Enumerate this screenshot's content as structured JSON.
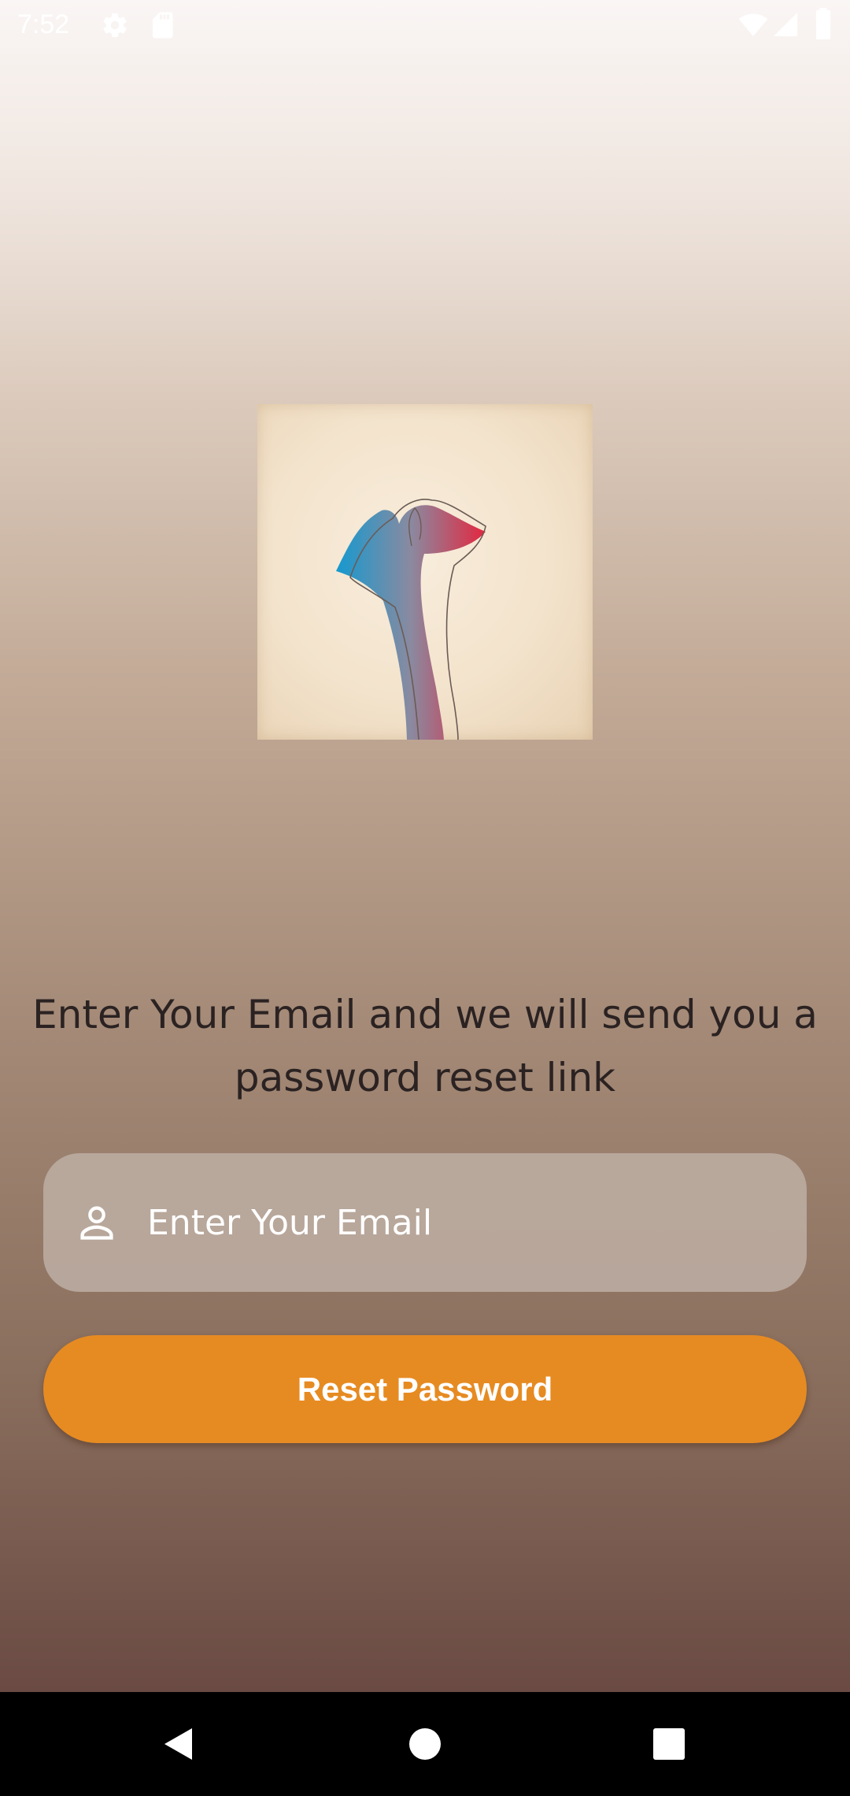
{
  "status_bar": {
    "time": "7:52",
    "icons": [
      "settings-icon",
      "sd-card-icon",
      "wifi-icon",
      "signal-icon",
      "battery-icon"
    ]
  },
  "illustration": {
    "description_icon": "ginkgo-leaf-illustration"
  },
  "reset": {
    "prompt": "Enter Your Email and we will send you a password reset link",
    "email_placeholder": "Enter Your Email",
    "email_value": "",
    "button_label": "Reset Password"
  },
  "colors": {
    "accent": "#e68b22",
    "field_bg": "#bbaaa0",
    "text_dark": "#2b2222"
  },
  "nav_bar": {
    "buttons": [
      "back-icon",
      "home-icon",
      "recents-icon"
    ]
  }
}
